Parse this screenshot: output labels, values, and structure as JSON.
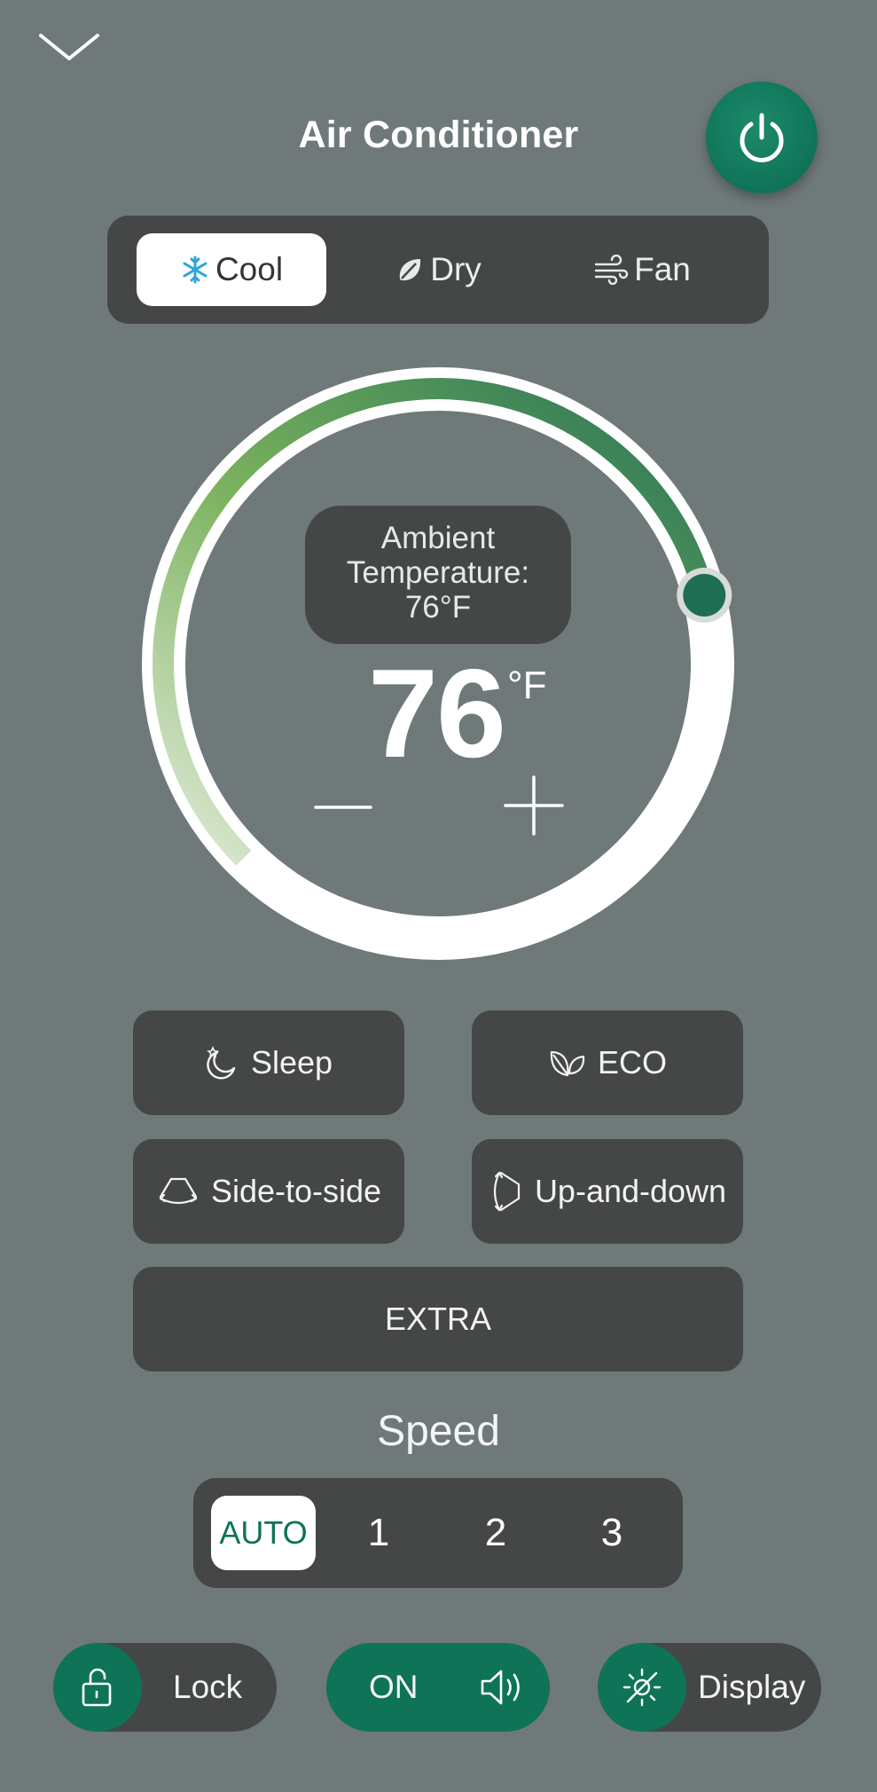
{
  "header": {
    "title": "Air Conditioner",
    "collapse_icon": "chevron-down-icon",
    "power_icon": "power-icon"
  },
  "modes": {
    "selected": "Cool",
    "items": [
      {
        "label": "Cool",
        "icon": "snowflake-icon"
      },
      {
        "label": "Dry",
        "icon": "leaf-drop-icon"
      },
      {
        "label": "Fan",
        "icon": "wind-icon"
      }
    ]
  },
  "thermostat": {
    "ambient_line1": "Ambient",
    "ambient_line2": "Temperature:",
    "ambient_line3": "76°F",
    "setpoint": "76",
    "unit": "°F",
    "minus_icon": "minus-icon",
    "plus_icon": "plus-icon",
    "dial_level": 0.78
  },
  "functions": {
    "sleep": {
      "label": "Sleep",
      "icon": "moon-star-icon"
    },
    "eco": {
      "label": "ECO",
      "icon": "eco-leaf-icon"
    },
    "side_to_side": {
      "label": "Side-to-side",
      "icon": "swing-horizontal-icon"
    },
    "up_and_down": {
      "label": "Up-and-down",
      "icon": "swing-vertical-icon"
    },
    "extra": {
      "label": "EXTRA"
    }
  },
  "speed": {
    "title": "Speed",
    "selected": "AUTO",
    "options": [
      "AUTO",
      "1",
      "2",
      "3"
    ]
  },
  "toggles": {
    "lock": {
      "label": "Lock",
      "icon": "unlock-icon"
    },
    "sound": {
      "label": "ON",
      "icon": "speaker-icon"
    },
    "display": {
      "label": "Display",
      "icon": "brightness-off-icon"
    }
  },
  "colors": {
    "background": "#6f7979",
    "panel": "#444746",
    "accent": "#0f7358",
    "arc_start": "#e2ecda",
    "arc_mid": "#7bb25d",
    "arc_end": "#257256"
  }
}
